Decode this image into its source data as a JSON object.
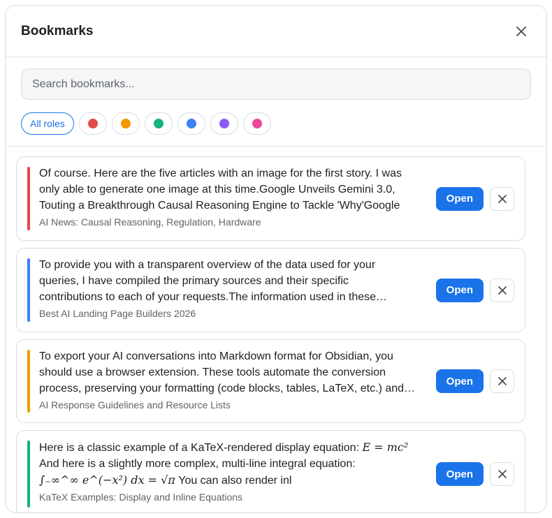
{
  "header": {
    "title": "Bookmarks",
    "close_icon": "close-icon"
  },
  "search": {
    "placeholder": "Search bookmarks..."
  },
  "filters": {
    "all_label": "All roles",
    "colors": [
      "#e34a4a",
      "#f29900",
      "#14b37a",
      "#3b82f6",
      "#8b5cf6",
      "#ec4899"
    ]
  },
  "bookmarks": [
    {
      "accent": "#e34a4a",
      "line1": "Of course. Here are the five articles with an image for the first story. I was",
      "line2": "only able to generate one image at this time.Google Unveils Gemini 3.0,",
      "line3": "Touting a Breakthrough Causal Reasoning Engine to Tackle 'Why'Google",
      "subtitle": "AI News: Causal Reasoning, Regulation, Hardware",
      "open_label": "Open"
    },
    {
      "accent": "#3b82f6",
      "line1": "To provide you with a transparent overview of the data used for your",
      "line2": "queries, I have compiled the primary sources and their specific",
      "line3": "contributions to each of your requests.The information used in these…",
      "subtitle": "Best AI Landing Page Builders 2026",
      "open_label": "Open"
    },
    {
      "accent": "#f29900",
      "line1": "To export your AI conversations into Markdown format for Obsidian, you",
      "line2": "should use a browser extension. These tools automate the conversion",
      "line3": "process, preserving your formatting (code blocks, tables, LaTeX, etc.) and…",
      "subtitle": "AI Response Guidelines and Resource Lists",
      "open_label": "Open"
    },
    {
      "accent": "#14b37a",
      "line1": "Here is a classic example of a KaTeX-rendered display equation:",
      "eq1": "E = mc²",
      "line2": "And here is a slightly more complex, multi-line integral equation:",
      "eq2": "∫₋∞^∞ e^(−x²) dx = √π",
      "line3_tail": "You can also render inl",
      "subtitle": "KaTeX Examples: Display and Inline Equations",
      "open_label": "Open"
    }
  ]
}
